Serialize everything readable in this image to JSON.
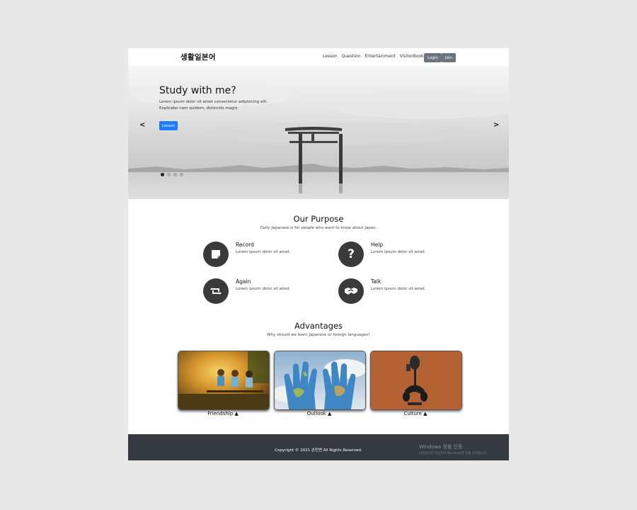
{
  "nav": {
    "brand": "생활일본어",
    "items": [
      "Lesson",
      "Question",
      "Entertainment",
      "VisitorBook"
    ],
    "login": "Login",
    "join": "Join"
  },
  "hero": {
    "title": "Study with me?",
    "text_line1": "Lorem ipsum dolor sit amet consectetur adipisicing elit.",
    "text_line2": "Explicabo nam quidem, distinctio magni.",
    "button": "Lesson",
    "prev": "<",
    "next": ">",
    "slide_count": 4,
    "active_slide": 1
  },
  "purpose": {
    "title": "Our Purpose",
    "subtitle": "Daily Japanese is for people who want to know about Japan.",
    "features": [
      {
        "title": "Record",
        "text": "Lorem ipsum dolor sit amet.",
        "icon": "sticky-note-icon"
      },
      {
        "title": "Help",
        "text": "Lorem ipsum dolor sit amet.",
        "icon": "question-icon"
      },
      {
        "title": "Again",
        "text": "Lorem ipsum dolor sit amet.",
        "icon": "retweet-icon"
      },
      {
        "title": "Talk",
        "text": "Lorem ipsum dolor sit amet.",
        "icon": "handshake-icon"
      }
    ]
  },
  "advantages": {
    "title": "Advantages",
    "subtitle": "Why should we learn Japanese or foreign languages?",
    "cards": [
      {
        "label": "Friendship ▲"
      },
      {
        "label": "Outlook ▲"
      },
      {
        "label": "Culture ▲"
      }
    ]
  },
  "footer": {
    "copyright": "Copyright © 2021 손민변 All Rights Reserved.",
    "windows_title": "Windows 정품 인증",
    "windows_text": "[설정]으로 이동하여 Windows를 정품 인증합니다."
  }
}
